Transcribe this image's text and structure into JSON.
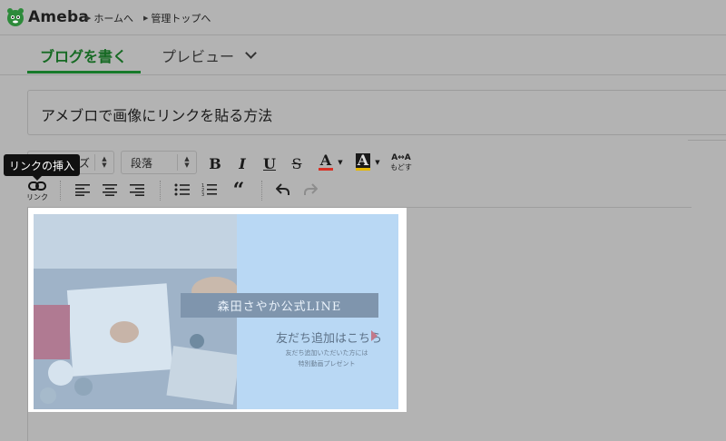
{
  "header": {
    "logo_text": "Ameba",
    "links": [
      "ホームへ",
      "管理トップへ"
    ]
  },
  "tabs": {
    "write": "ブログを書く",
    "preview": "プレビュー"
  },
  "post": {
    "title": "アメブロで画像にリンクを貼る方法"
  },
  "toolbar": {
    "size_select": "ズ",
    "paragraph_select": "段落",
    "bold": "B",
    "italic": "I",
    "underline": "U",
    "strike": "S",
    "font_color": "A",
    "bg_color": "A",
    "reset_top": "A↔A",
    "reset_label": "もどす",
    "quote": "“",
    "link_label": "リンク",
    "tooltip": "リンクの挿入"
  },
  "image": {
    "banner": "森田さやか公式LINE",
    "friend_text": "友だち追加はこちら",
    "sub_line1": "友だち追加いただいた方には",
    "sub_line2": "特別動画プレゼント"
  },
  "colors": {
    "accent": "#177a2a",
    "overlay": "#b3b3b3",
    "selected_image": "#b9d8f4",
    "font_color_bar": "#d93025",
    "bg_color_bar": "#e6b800"
  }
}
